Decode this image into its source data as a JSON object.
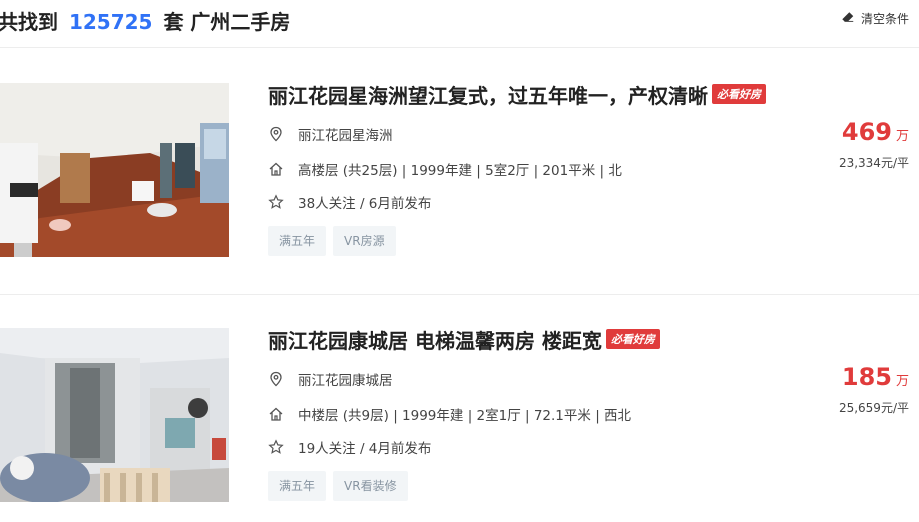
{
  "header": {
    "prefix": "共找到",
    "count": "125725",
    "suffix": "套 广州二手房",
    "clear_label": "清空条件"
  },
  "listings": [
    {
      "title": "丽江花园星海洲望江复式，过五年唯一，产权清晰",
      "badge": "必看好房",
      "community": "丽江花园星海洲",
      "house_info": "高楼层 (共25层) | 1999年建 | 5室2厅 | 201平米 | 北",
      "follow_info": "38人关注 / 6月前发布",
      "tags": [
        "满五年",
        "VR房源"
      ],
      "total_price": "469",
      "total_unit": "万",
      "unit_price": "23,334元/平"
    },
    {
      "title": "丽江花园康城居 电梯温馨两房 楼距宽",
      "badge": "必看好房",
      "community": "丽江花园康城居",
      "house_info": "中楼层 (共9层) | 1999年建 | 2室1厅 | 72.1平米 | 西北",
      "follow_info": "19人关注 / 4月前发布",
      "tags": [
        "满五年",
        "VR看装修"
      ],
      "total_price": "185",
      "total_unit": "万",
      "unit_price": "25,659元/平"
    }
  ],
  "icons": {
    "location": "location-pin-icon",
    "house": "house-icon",
    "star": "star-icon",
    "eraser": "eraser-icon"
  },
  "colors": {
    "accent_blue": "#3072f6",
    "price_red": "#e03b3b",
    "tag_bg": "#f2f5f7",
    "tag_text": "#8794a1"
  }
}
